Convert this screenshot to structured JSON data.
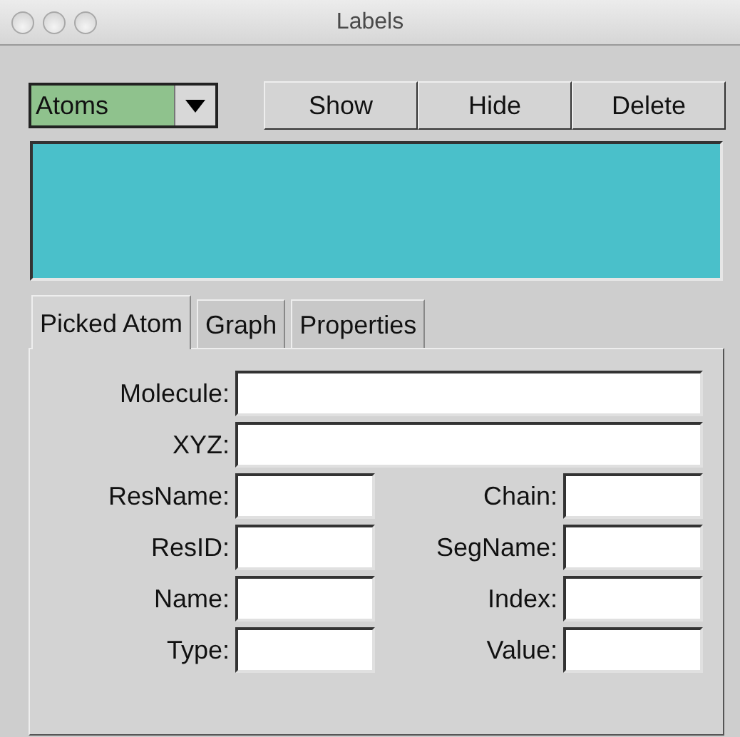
{
  "window": {
    "title": "Labels"
  },
  "type_menu": {
    "value": "Atoms"
  },
  "buttons": [
    "Show",
    "Hide",
    "Delete"
  ],
  "tabs": [
    {
      "label": "Picked Atom",
      "selected": true
    },
    {
      "label": "Graph",
      "selected": false
    },
    {
      "label": "Properties",
      "selected": false
    }
  ],
  "form": {
    "rows": [
      {
        "kind": "wide",
        "fields": [
          {
            "label": "Molecule:"
          }
        ]
      },
      {
        "kind": "wide",
        "fields": [
          {
            "label": "XYZ:"
          }
        ]
      },
      {
        "kind": "pair",
        "fields": [
          {
            "label": "ResName:"
          },
          {
            "label": "Chain:"
          }
        ]
      },
      {
        "kind": "pair",
        "fields": [
          {
            "label": "ResID:"
          },
          {
            "label": "SegName:"
          }
        ]
      },
      {
        "kind": "pair",
        "fields": [
          {
            "label": "Name:"
          },
          {
            "label": "Index:"
          }
        ]
      },
      {
        "kind": "pair",
        "fields": [
          {
            "label": "Type:"
          },
          {
            "label": "Value:"
          }
        ]
      }
    ]
  }
}
